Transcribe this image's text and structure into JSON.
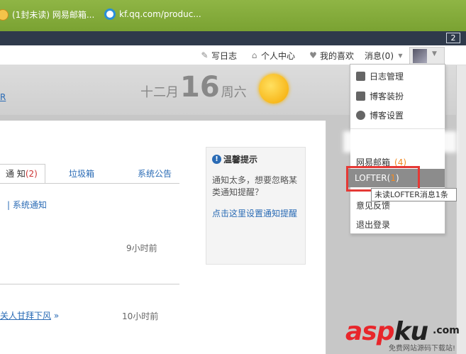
{
  "browser": {
    "bookmark_mail": "(1封未读) 网易邮箱...",
    "bookmark_qq": "kf.qq.com/produc...",
    "tab_count": "2"
  },
  "topnav": {
    "write": "写日志",
    "personal": "个人中心",
    "likes": "我的喜欢",
    "messages": "消息(0)"
  },
  "header": {
    "link_fragment": "R",
    "month": "十二月",
    "day": "16",
    "weekday": "周六"
  },
  "tabs": {
    "notice": "通 知",
    "notice_count": "(2)",
    "spam": "垃圾箱",
    "system": "系统公告"
  },
  "main": {
    "sys_notice": "|   系统通知",
    "time1": "9小时前",
    "post_link": "关人甘拜下风",
    "post_tail": "»",
    "time2": "10小时前"
  },
  "tip": {
    "title": "温馨提示",
    "text": "通知太多，想要忽略某类通知提醒？",
    "link": "点击这里设置通知提醒"
  },
  "dropdown": {
    "items": [
      "日志管理",
      "博客装扮",
      "博客设置"
    ],
    "mail": "网易邮箱",
    "mail_count": "(4)",
    "lofter": "LOFTER",
    "lofter_count_open": "(",
    "lofter_count": "1",
    "lofter_count_close": ")",
    "feedback": "意见反馈",
    "logout": "退出登录"
  },
  "tooltip": "未读LOFTER消息1条",
  "watermark": {
    "main_a": "asp",
    "main_b": "ku",
    "com": ".com",
    "sub": "免费网站源码下载站!"
  }
}
